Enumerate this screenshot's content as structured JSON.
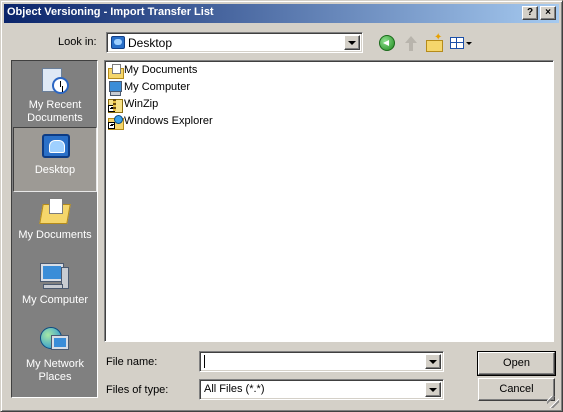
{
  "window": {
    "title": "Object Versioning - Import Transfer List",
    "help_label": "?",
    "close_label": "×"
  },
  "lookin": {
    "label": "Look in:",
    "value": "Desktop"
  },
  "toolbar": {
    "icons": [
      "back-icon",
      "up-folder-icon",
      "new-folder-icon",
      "views-menu-icon"
    ]
  },
  "places": [
    {
      "label": "My Recent Documents",
      "icon": "recent-documents-icon"
    },
    {
      "label": "Desktop",
      "icon": "desktop-icon"
    },
    {
      "label": "My Documents",
      "icon": "my-documents-icon"
    },
    {
      "label": "My Computer",
      "icon": "my-computer-icon"
    },
    {
      "label": "My Network Places",
      "icon": "my-network-places-icon"
    }
  ],
  "files": [
    {
      "name": "My Documents",
      "icon": "folder-documents-icon"
    },
    {
      "name": "My Computer",
      "icon": "computer-icon"
    },
    {
      "name": "WinZip",
      "icon": "winzip-shortcut-icon"
    },
    {
      "name": "Windows Explorer",
      "icon": "explorer-shortcut-icon"
    }
  ],
  "form": {
    "file_name_label": "File name:",
    "file_name_value": "",
    "file_type_label": "Files of type:",
    "file_type_value": "All Files (*.*)",
    "open_label": "Open",
    "cancel_label": "Cancel"
  }
}
